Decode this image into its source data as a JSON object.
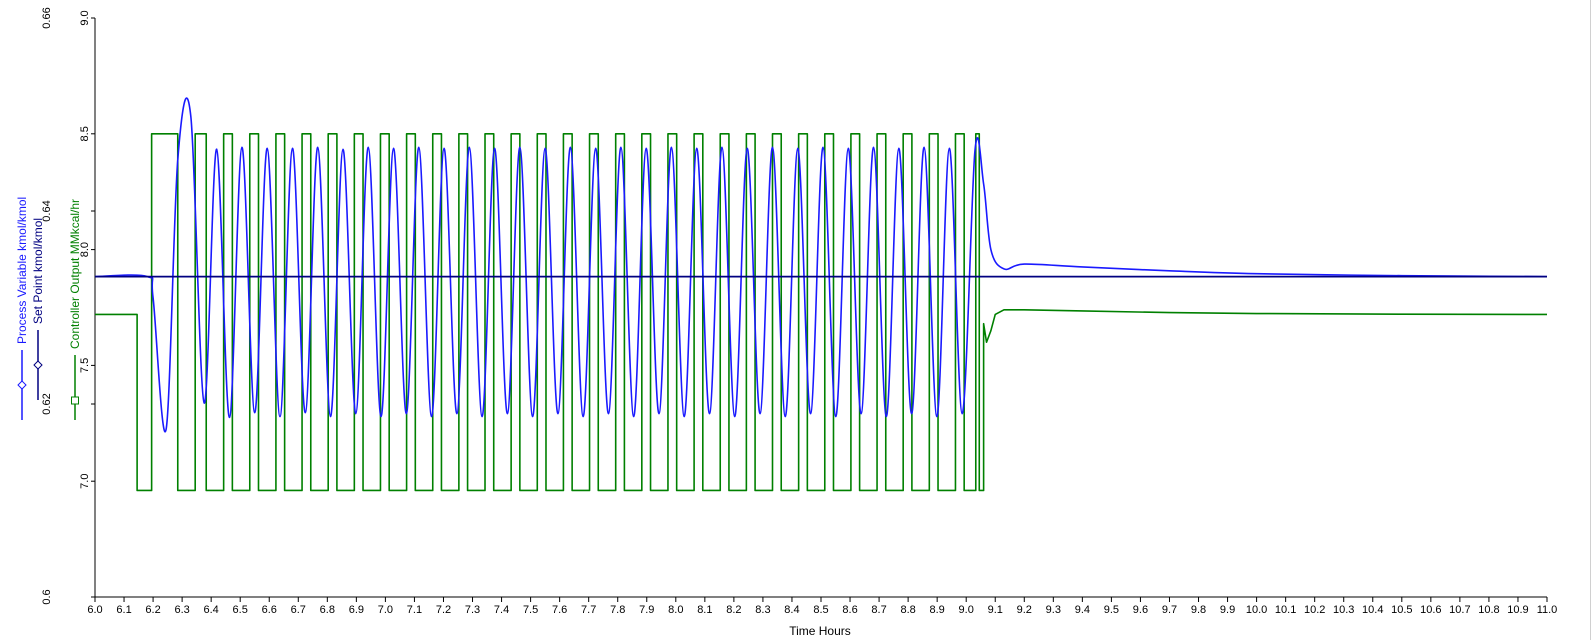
{
  "chart_data": {
    "type": "line",
    "title": "",
    "xlabel": "Time Hours",
    "xlim": [
      6.0,
      11.0
    ],
    "x_ticks": [
      "6.0",
      "6.1",
      "6.2",
      "6.3",
      "6.4",
      "6.5",
      "6.6",
      "6.7",
      "6.8",
      "6.9",
      "7.0",
      "7.1",
      "7.2",
      "7.3",
      "7.4",
      "7.5",
      "7.6",
      "7.7",
      "7.8",
      "7.9",
      "8.0",
      "8.1",
      "8.2",
      "8.3",
      "8.4",
      "8.5",
      "8.6",
      "8.7",
      "8.8",
      "8.9",
      "9.0",
      "9.1",
      "9.2",
      "9.3",
      "9.4",
      "9.5",
      "9.6",
      "9.7",
      "9.8",
      "9.9",
      "10.0",
      "10.1",
      "10.2",
      "10.3",
      "10.4",
      "10.5",
      "10.6",
      "10.7",
      "10.8",
      "10.9",
      "11.0"
    ],
    "left_axis": {
      "label_process_variable": "Process Variable kmol/kmol",
      "label_set_point": "Set Point kmol/kmol",
      "ylim": [
        0.6,
        0.66
      ],
      "ticks": [
        "0.6",
        "0.62",
        "0.64",
        "0.66"
      ]
    },
    "right_axis": {
      "label": "Controller Output MMkcal/hr",
      "ylim": [
        6.5,
        9.0
      ],
      "ticks": [
        "7.0",
        "7.5",
        "8.0",
        "8.5",
        "9.0"
      ]
    },
    "colors": {
      "process_variable": "#1a1aff",
      "set_point": "#000080",
      "controller_output": "#008000",
      "axis": "#000000"
    },
    "series": [
      {
        "name": "Process Variable kmol/kmol",
        "axis": "left",
        "points": [
          [
            6.0,
            0.6332
          ],
          [
            6.18,
            0.6332
          ],
          [
            6.2,
            0.631
          ],
          [
            6.245,
            0.6174
          ],
          [
            6.285,
            0.6453
          ],
          [
            6.33,
            0.6498
          ],
          [
            6.376,
            0.6201
          ],
          [
            6.419,
            0.6464
          ],
          [
            6.463,
            0.6186
          ],
          [
            6.506,
            0.6466
          ],
          [
            6.55,
            0.6191
          ],
          [
            6.593,
            0.6465
          ],
          [
            6.637,
            0.6187
          ],
          [
            6.68,
            0.6465
          ],
          [
            6.724,
            0.6191
          ],
          [
            6.767,
            0.6466
          ],
          [
            6.811,
            0.6187
          ],
          [
            6.854,
            0.6464
          ],
          [
            6.898,
            0.619
          ],
          [
            6.941,
            0.6466
          ],
          [
            6.985,
            0.6187
          ],
          [
            7.028,
            0.6465
          ],
          [
            7.072,
            0.619
          ],
          [
            7.115,
            0.6466
          ],
          [
            7.159,
            0.6187
          ],
          [
            7.202,
            0.6465
          ],
          [
            7.246,
            0.619
          ],
          [
            7.289,
            0.6466
          ],
          [
            7.333,
            0.6187
          ],
          [
            7.376,
            0.6465
          ],
          [
            7.42,
            0.619
          ],
          [
            7.463,
            0.6466
          ],
          [
            7.507,
            0.6187
          ],
          [
            7.55,
            0.6465
          ],
          [
            7.594,
            0.619
          ],
          [
            7.637,
            0.6466
          ],
          [
            7.681,
            0.6187
          ],
          [
            7.724,
            0.6465
          ],
          [
            7.768,
            0.619
          ],
          [
            7.811,
            0.6466
          ],
          [
            7.855,
            0.6187
          ],
          [
            7.898,
            0.6465
          ],
          [
            7.942,
            0.619
          ],
          [
            7.985,
            0.6466
          ],
          [
            8.029,
            0.6187
          ],
          [
            8.072,
            0.6465
          ],
          [
            8.116,
            0.619
          ],
          [
            8.159,
            0.6466
          ],
          [
            8.203,
            0.6187
          ],
          [
            8.246,
            0.6465
          ],
          [
            8.29,
            0.619
          ],
          [
            8.333,
            0.6466
          ],
          [
            8.377,
            0.6187
          ],
          [
            8.42,
            0.6465
          ],
          [
            8.464,
            0.619
          ],
          [
            8.507,
            0.6466
          ],
          [
            8.551,
            0.6187
          ],
          [
            8.594,
            0.6465
          ],
          [
            8.638,
            0.619
          ],
          [
            8.681,
            0.6466
          ],
          [
            8.725,
            0.6187
          ],
          [
            8.768,
            0.6465
          ],
          [
            8.812,
            0.619
          ],
          [
            8.855,
            0.6466
          ],
          [
            8.899,
            0.6187
          ],
          [
            8.942,
            0.6465
          ],
          [
            8.986,
            0.619
          ],
          [
            9.03,
            0.6462
          ],
          [
            9.06,
            0.6428
          ],
          [
            9.085,
            0.636
          ],
          [
            9.13,
            0.634
          ],
          [
            9.2,
            0.6345
          ],
          [
            9.4,
            0.6342
          ],
          [
            9.7,
            0.6338
          ],
          [
            10.0,
            0.6335
          ],
          [
            10.5,
            0.6333
          ],
          [
            11.0,
            0.6332
          ]
        ]
      },
      {
        "name": "Set Point kmol/kmol",
        "axis": "left",
        "points": [
          [
            6.0,
            0.6332
          ],
          [
            11.0,
            0.6332
          ]
        ]
      },
      {
        "name": "Controller Output MMkcal/hr",
        "axis": "right",
        "points": [
          [
            6.0,
            7.72
          ],
          [
            6.145,
            7.72
          ],
          [
            6.145,
            6.96
          ],
          [
            6.195,
            6.96
          ],
          [
            6.195,
            8.5
          ],
          [
            6.285,
            8.5
          ],
          [
            6.285,
            6.96
          ],
          [
            6.345,
            6.96
          ],
          [
            6.345,
            8.5
          ],
          [
            6.383,
            8.5
          ],
          [
            6.383,
            6.96
          ],
          [
            6.443,
            6.96
          ],
          [
            6.443,
            8.5
          ],
          [
            6.473,
            8.5
          ],
          [
            6.473,
            6.96
          ],
          [
            6.533,
            6.96
          ],
          [
            6.533,
            8.5
          ],
          [
            6.563,
            8.5
          ],
          [
            6.563,
            6.96
          ],
          [
            6.623,
            6.96
          ],
          [
            6.623,
            8.5
          ],
          [
            6.653,
            8.5
          ],
          [
            6.653,
            6.96
          ],
          [
            6.713,
            6.96
          ],
          [
            6.713,
            8.5
          ],
          [
            6.743,
            8.5
          ],
          [
            6.743,
            6.96
          ],
          [
            6.803,
            6.96
          ],
          [
            6.803,
            8.5
          ],
          [
            6.833,
            8.5
          ],
          [
            6.833,
            6.96
          ],
          [
            6.893,
            6.96
          ],
          [
            6.893,
            8.5
          ],
          [
            6.923,
            8.5
          ],
          [
            6.923,
            6.96
          ],
          [
            6.983,
            6.96
          ],
          [
            6.983,
            8.5
          ],
          [
            7.013,
            8.5
          ],
          [
            7.013,
            6.96
          ],
          [
            7.073,
            6.96
          ],
          [
            7.073,
            8.5
          ],
          [
            7.103,
            8.5
          ],
          [
            7.103,
            6.96
          ],
          [
            7.163,
            6.96
          ],
          [
            7.163,
            8.5
          ],
          [
            7.193,
            8.5
          ],
          [
            7.193,
            6.96
          ],
          [
            7.253,
            6.96
          ],
          [
            7.253,
            8.5
          ],
          [
            7.283,
            8.5
          ],
          [
            7.283,
            6.96
          ],
          [
            7.343,
            6.96
          ],
          [
            7.343,
            8.5
          ],
          [
            7.373,
            8.5
          ],
          [
            7.373,
            6.96
          ],
          [
            7.433,
            6.96
          ],
          [
            7.433,
            8.5
          ],
          [
            7.463,
            8.5
          ],
          [
            7.463,
            6.96
          ],
          [
            7.523,
            6.96
          ],
          [
            7.523,
            8.5
          ],
          [
            7.553,
            8.5
          ],
          [
            7.553,
            6.96
          ],
          [
            7.613,
            6.96
          ],
          [
            7.613,
            8.5
          ],
          [
            7.643,
            8.5
          ],
          [
            7.643,
            6.96
          ],
          [
            7.703,
            6.96
          ],
          [
            7.703,
            8.5
          ],
          [
            7.733,
            8.5
          ],
          [
            7.733,
            6.96
          ],
          [
            7.793,
            6.96
          ],
          [
            7.793,
            8.5
          ],
          [
            7.823,
            8.5
          ],
          [
            7.823,
            6.96
          ],
          [
            7.883,
            6.96
          ],
          [
            7.883,
            8.5
          ],
          [
            7.913,
            8.5
          ],
          [
            7.913,
            6.96
          ],
          [
            7.973,
            6.96
          ],
          [
            7.973,
            8.5
          ],
          [
            8.003,
            8.5
          ],
          [
            8.003,
            6.96
          ],
          [
            8.063,
            6.96
          ],
          [
            8.063,
            8.5
          ],
          [
            8.093,
            8.5
          ],
          [
            8.093,
            6.96
          ],
          [
            8.153,
            6.96
          ],
          [
            8.153,
            8.5
          ],
          [
            8.183,
            8.5
          ],
          [
            8.183,
            6.96
          ],
          [
            8.243,
            6.96
          ],
          [
            8.243,
            8.5
          ],
          [
            8.273,
            8.5
          ],
          [
            8.273,
            6.96
          ],
          [
            8.333,
            6.96
          ],
          [
            8.333,
            8.5
          ],
          [
            8.363,
            8.5
          ],
          [
            8.363,
            6.96
          ],
          [
            8.423,
            6.96
          ],
          [
            8.423,
            8.5
          ],
          [
            8.453,
            8.5
          ],
          [
            8.453,
            6.96
          ],
          [
            8.513,
            6.96
          ],
          [
            8.513,
            8.5
          ],
          [
            8.543,
            8.5
          ],
          [
            8.543,
            6.96
          ],
          [
            8.603,
            6.96
          ],
          [
            8.603,
            8.5
          ],
          [
            8.633,
            8.5
          ],
          [
            8.633,
            6.96
          ],
          [
            8.693,
            6.96
          ],
          [
            8.693,
            8.5
          ],
          [
            8.723,
            8.5
          ],
          [
            8.723,
            6.96
          ],
          [
            8.783,
            6.96
          ],
          [
            8.783,
            8.5
          ],
          [
            8.813,
            8.5
          ],
          [
            8.813,
            6.96
          ],
          [
            8.873,
            6.96
          ],
          [
            8.873,
            8.5
          ],
          [
            8.903,
            8.5
          ],
          [
            8.903,
            6.96
          ],
          [
            8.963,
            6.96
          ],
          [
            8.963,
            8.5
          ],
          [
            8.993,
            8.5
          ],
          [
            8.993,
            6.96
          ],
          [
            9.033,
            6.96
          ],
          [
            9.033,
            8.5
          ],
          [
            9.045,
            8.5
          ],
          [
            9.045,
            6.96
          ],
          [
            9.06,
            6.96
          ],
          [
            9.06,
            7.68
          ],
          [
            9.07,
            7.6
          ],
          [
            9.085,
            7.65
          ],
          [
            9.1,
            7.72
          ],
          [
            9.13,
            7.74
          ],
          [
            9.2,
            7.74
          ],
          [
            9.4,
            7.735
          ],
          [
            9.7,
            7.728
          ],
          [
            10.0,
            7.724
          ],
          [
            10.5,
            7.721
          ],
          [
            11.0,
            7.72
          ]
        ]
      }
    ],
    "legend": [
      {
        "label": "Process Variable kmol/kmol",
        "marker": "diamond",
        "color": "#1a1aff"
      },
      {
        "label": "Set Point kmol/kmol",
        "marker": "diamond",
        "color": "#000080"
      },
      {
        "label": "Controller Output MMkcal/hr",
        "marker": "square",
        "color": "#008000"
      }
    ],
    "grid": false,
    "legend_placement": "left, rotated along y-axis"
  }
}
